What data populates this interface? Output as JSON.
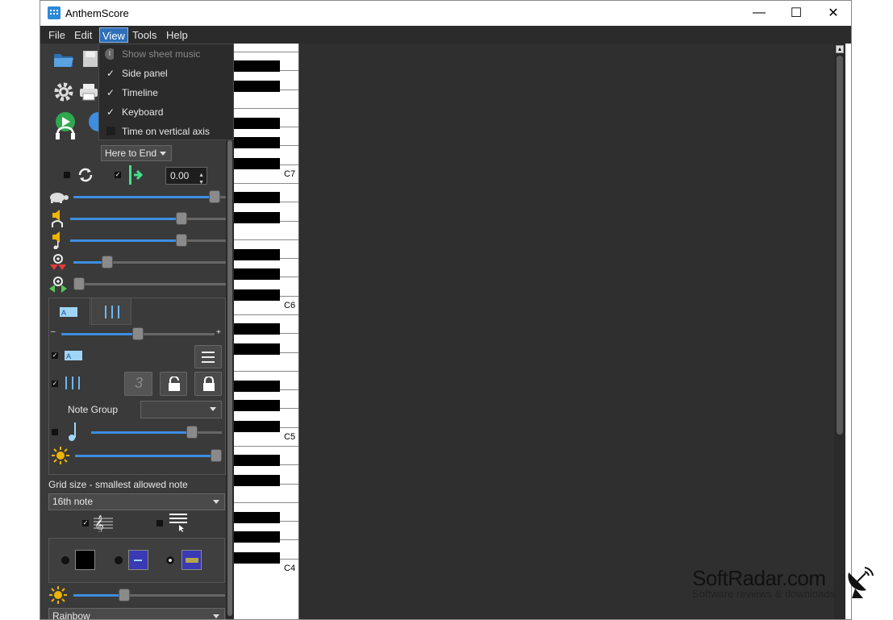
{
  "window": {
    "title": "AnthemScore",
    "minimize": "—",
    "maximize": "☐",
    "close": "✕"
  },
  "menu": {
    "file": "File",
    "edit": "Edit",
    "view": "View",
    "tools": "Tools",
    "help": "Help"
  },
  "view_menu": [
    {
      "label": "Show sheet music",
      "checked": false,
      "disabled": true
    },
    {
      "label": "Side panel",
      "checked": true,
      "disabled": false
    },
    {
      "label": "Timeline",
      "checked": true,
      "disabled": false
    },
    {
      "label": "Keyboard",
      "checked": true,
      "disabled": false
    },
    {
      "label": "Time on vertical axis",
      "checked": false,
      "disabled": false
    }
  ],
  "check_mark": "✓",
  "playback": {
    "range": "Here to End",
    "offset": "0.00"
  },
  "sliders": {
    "speed": 0.96,
    "volume_audio": 0.73,
    "volume_notes": 0.73,
    "zoom_v": 0.2,
    "zoom_h": 0.0,
    "tab_zoom": 0.5,
    "note_length": 0.8,
    "brightness": 1.0,
    "bottom_brightness": 0.32
  },
  "note_group": {
    "label": "Note Group",
    "value": ""
  },
  "grid": {
    "label": "Grid size - smallest allowed note",
    "value": "16th note"
  },
  "colormap": {
    "value": "Rainbow"
  },
  "keyboard": {
    "labels": [
      "C7",
      "C6",
      "C5",
      "C4"
    ]
  },
  "watermark": {
    "title": "SoftRadar.com",
    "subtitle": "Software reviews & downloads"
  },
  "colors": {
    "accent": "#3d8ee0",
    "menu_highlight": "#2e6fb8",
    "panel": "#3a3a3a",
    "canvas": "#2f2f2f"
  }
}
